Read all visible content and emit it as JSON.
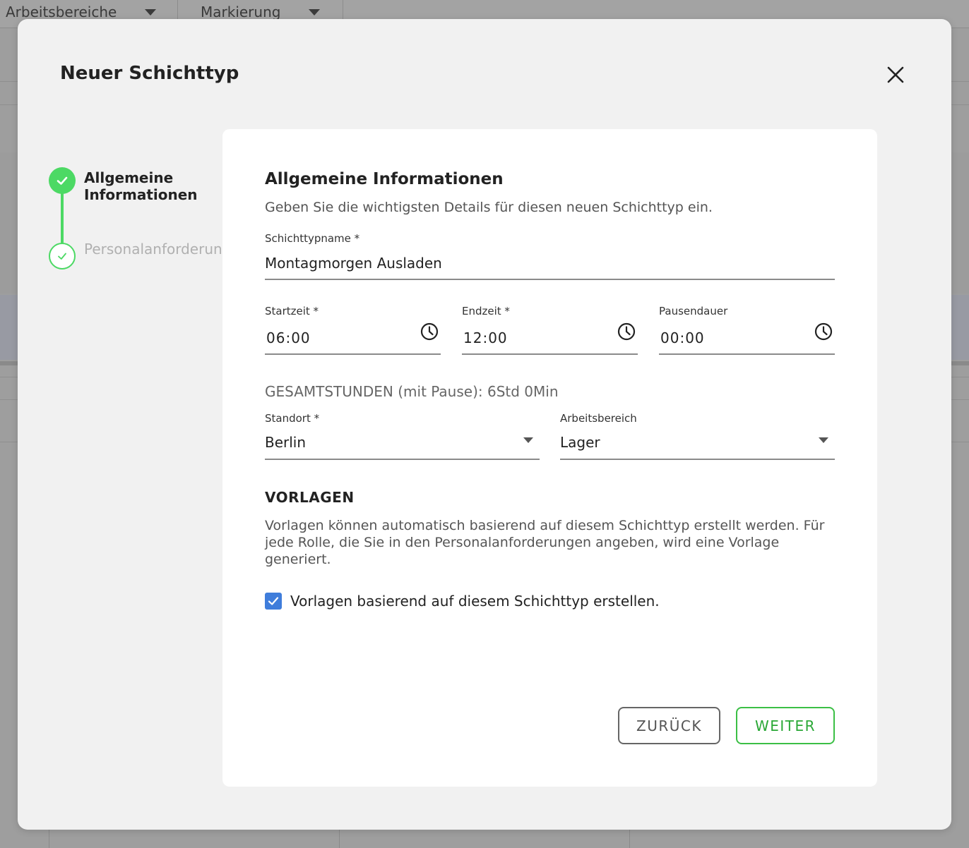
{
  "background": {
    "tabs": [
      {
        "label": "Arbeitsbereiche"
      },
      {
        "label": "Markierung"
      }
    ]
  },
  "modal": {
    "title": "Neuer Schichttyp"
  },
  "stepper": {
    "steps": [
      {
        "label": "Allgemeine Informationen",
        "state": "done"
      },
      {
        "label": "Personalanforderungen",
        "state": "pending"
      }
    ]
  },
  "form": {
    "section_title": "Allgemeine Informationen",
    "section_desc": "Geben Sie die wichtigsten Details für diesen neuen Schichttyp ein.",
    "name": {
      "label": "Schichttypname *",
      "value": "Montagmorgen Ausladen"
    },
    "start": {
      "label": "Startzeit *",
      "value": "06:00"
    },
    "end": {
      "label": "Endzeit *",
      "value": "12:00"
    },
    "pause": {
      "label": "Pausendauer",
      "value": "00:00"
    },
    "total": "GESAMTSTUNDEN (mit Pause): 6Std 0Min",
    "location": {
      "label": "Standort *",
      "value": "Berlin"
    },
    "area": {
      "label": "Arbeitsbereich",
      "value": "Lager"
    },
    "templates_title": "VORLAGEN",
    "templates_desc": "Vorlagen können automatisch basierend auf diesem Schichttyp erstellt werden. Für jede Rolle, die Sie in den Personalanforderungen angeben, wird eine Vorlage generiert.",
    "checkbox_label": "Vorlagen basierend auf diesem Schichttyp erstellen.",
    "checkbox_checked": true
  },
  "buttons": {
    "back": "ZURÜCK",
    "next": "WEITER"
  },
  "colors": {
    "accent_green": "#4cd964",
    "checkbox_blue": "#3f7ddb",
    "next_button_green": "#2aa836"
  }
}
